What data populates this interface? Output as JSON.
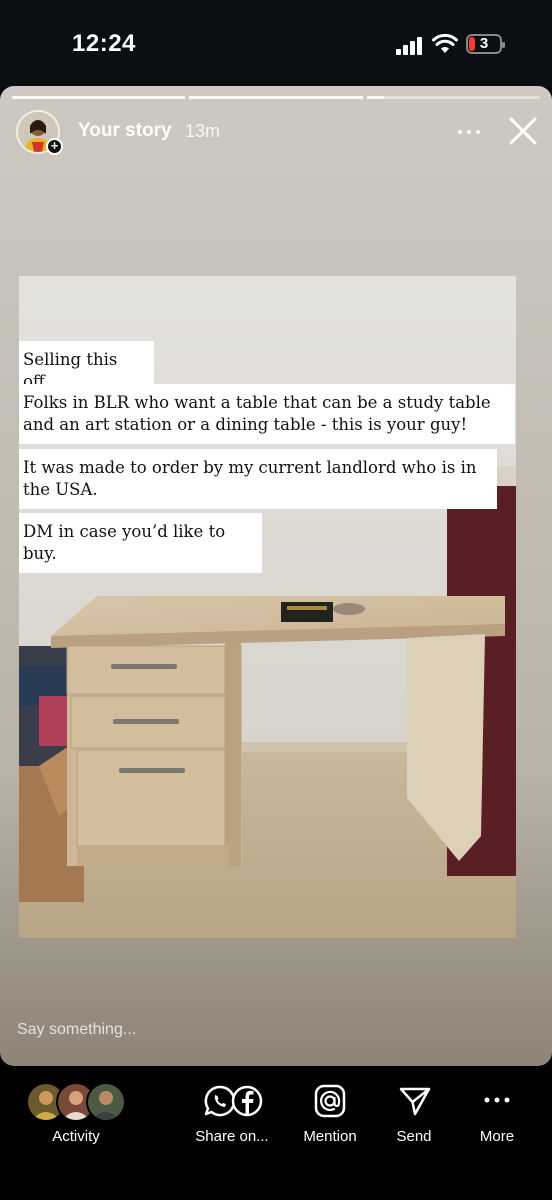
{
  "status_bar": {
    "time": "12:24",
    "battery": "3"
  },
  "story": {
    "author": "Your story",
    "posted_ago": "13m",
    "progress": [
      1.0,
      1.0,
      0.1
    ],
    "captions": [
      "Selling this off.",
      "Folks in BLR who want a table that can be a study table and an art station or a dining table - this is your guy!",
      "It was made to order by my current landlord who is in the USA.",
      "DM in case you’d like to buy."
    ],
    "reply_placeholder": "Say something..."
  },
  "bottom_bar": {
    "activity": "Activity",
    "share": "Share on...",
    "mention": "Mention",
    "send": "Send",
    "more": "More"
  },
  "icons": [
    "signal-icon",
    "wifi-icon",
    "battery-icon",
    "more-options-icon",
    "close-icon",
    "whatsapp-icon",
    "facebook-icon",
    "mention-icon",
    "send-icon",
    "more-icon"
  ]
}
